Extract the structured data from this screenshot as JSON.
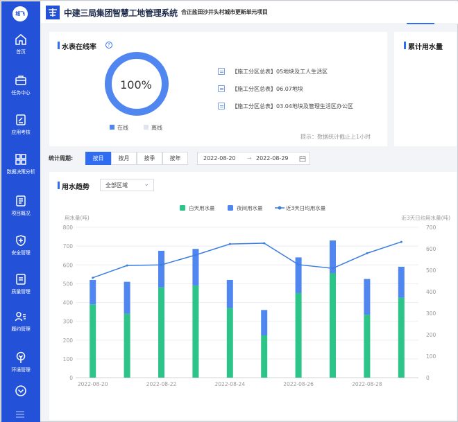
{
  "sidebar": {
    "logo_text": "城飞",
    "items": [
      {
        "label": "首页",
        "icon": "home-icon"
      },
      {
        "label": "任务中心",
        "icon": "briefcase-icon"
      },
      {
        "label": "应用考核",
        "icon": "edit-icon"
      },
      {
        "label": "数据决策分析",
        "icon": "grid-icon"
      },
      {
        "label": "项目概况",
        "icon": "document-icon"
      },
      {
        "label": "安全管理",
        "icon": "shield-icon"
      },
      {
        "label": "质量管理",
        "icon": "quality-icon"
      },
      {
        "label": "履约管理",
        "icon": "person-list-icon"
      },
      {
        "label": "环境管理",
        "icon": "tree-icon"
      }
    ],
    "expand_icon": "chevron-down-icon",
    "menu_icon": "menu-icon"
  },
  "header": {
    "title": "中建三局集团智慧工地管理系统",
    "project": "合正盐田沙井头村城市更新单元项目"
  },
  "meter_online": {
    "title": "水表在线率",
    "percent_label": "100%",
    "online_ratio": 1.0,
    "legend_online": "在线",
    "legend_offline": "离线",
    "meters": [
      "【施工分区总表】05地块及工人生活区",
      "【施工分区总表】06.07地块",
      "【施工分区总表】03.04地块及管理生活区办公区"
    ],
    "tip": "提示：数据统计截止上1小时"
  },
  "cumulative": {
    "title": "累计用水量"
  },
  "filter": {
    "label": "统计周期:",
    "periods": [
      "按日",
      "按月",
      "按季",
      "按年"
    ],
    "active_period": "按日",
    "date_start": "2022-08-20",
    "date_sep": "→",
    "date_end": "2022-08-29"
  },
  "trend": {
    "title": "用水趋势",
    "area_select": "全部区域"
  },
  "colors": {
    "primary": "#2f6cf2",
    "sidebar": "#2352d8",
    "day_bar": "#2cc489",
    "night_bar": "#4f86f0",
    "line": "#3b7ee0"
  },
  "chart_data": {
    "type": "bar",
    "ylabel_left": "用水量(吨)",
    "ylabel_right": "近3天日均用水量(吨)",
    "ylim_left": [
      0,
      800
    ],
    "ylim_right": [
      0,
      700
    ],
    "yticks_left": [
      "0",
      "100",
      "200",
      "300",
      "400",
      "500",
      "600",
      "700",
      "800"
    ],
    "yticks_right": [
      "0",
      "100",
      "200",
      "300",
      "400",
      "500",
      "600",
      "700"
    ],
    "x": [
      "2022-08-20",
      "2022-08-21",
      "2022-08-22",
      "2022-08-23",
      "2022-08-24",
      "2022-08-25",
      "2022-08-26",
      "2022-08-27",
      "2022-08-28",
      "2022-08-29"
    ],
    "x_tick_labels": [
      "2022-08-20",
      "",
      "2022-08-22",
      "",
      "2022-08-24",
      "",
      "2022-08-26",
      "",
      "2022-08-28",
      ""
    ],
    "legend_position": "top-center",
    "series": [
      {
        "name": "白天用水量",
        "kind": "bar",
        "stack": "total",
        "values": [
          390,
          340,
          480,
          490,
          370,
          225,
          450,
          555,
          335,
          425
        ]
      },
      {
        "name": "夜间用水量",
        "kind": "bar",
        "stack": "total",
        "values": [
          130,
          170,
          195,
          195,
          150,
          135,
          190,
          175,
          190,
          165
        ]
      },
      {
        "name": "近3天日均用水量",
        "kind": "line",
        "axis": "right",
        "values": [
          465,
          522,
          525,
          571,
          622,
          626,
          526,
          509,
          579,
          632
        ]
      }
    ]
  }
}
